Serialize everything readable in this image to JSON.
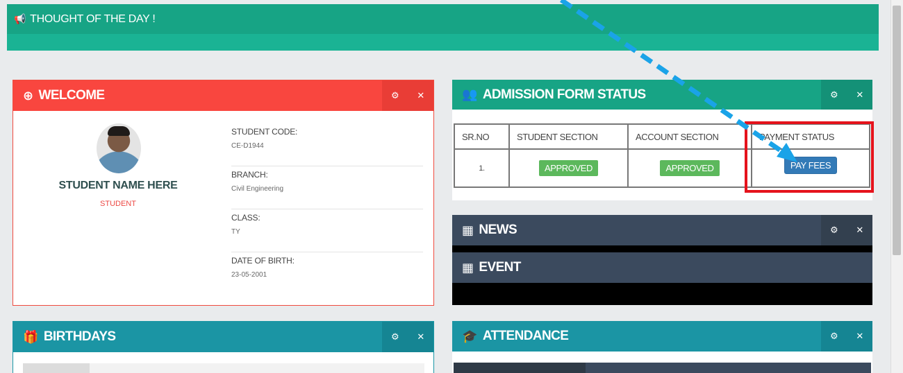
{
  "thought": {
    "title": "THOUGHT OF THE DAY !"
  },
  "welcome": {
    "title": "WELCOME",
    "student_name": "STUDENT NAME HERE",
    "student_role": "STUDENT",
    "fields": [
      {
        "label": "STUDENT CODE:",
        "value": "CE-D1944"
      },
      {
        "label": "BRANCH:",
        "value": "Civil Engineering"
      },
      {
        "label": "CLASS:",
        "value": "TY"
      },
      {
        "label": "DATE OF BIRTH:",
        "value": "23-05-2001"
      }
    ]
  },
  "admission": {
    "title": "ADMISSION FORM STATUS",
    "columns": [
      "SR.NO",
      "STUDENT SECTION",
      "ACCOUNT SECTION",
      "PAYMENT STATUS"
    ],
    "row": {
      "sr": "1.",
      "student_section": "APPROVED",
      "account_section": "APPROVED",
      "payment": "PAY FEES"
    }
  },
  "news": {
    "title": "NEWS"
  },
  "event": {
    "title": "EVENT"
  },
  "birthdays": {
    "title": "BIRTHDAYS"
  },
  "attendance": {
    "title": "ATTENDANCE"
  },
  "icons": {
    "settings": "gear-icon",
    "close": "close-icon"
  },
  "colors": {
    "teal": "#1ab394",
    "red": "#f9463f",
    "slate": "#3b4a5e",
    "cyan": "#1b95a4",
    "approved": "#5cb85c",
    "pay": "#337ab7",
    "annotation_arrow": "#1aa3e8",
    "highlight": "#e5131c"
  }
}
